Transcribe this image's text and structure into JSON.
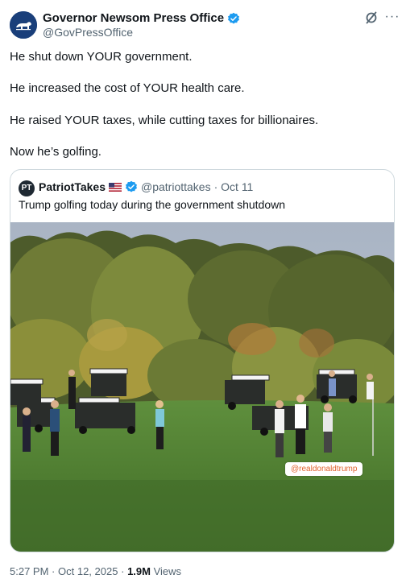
{
  "post": {
    "author_name": "Governor Newsom Press Office",
    "author_handle": "@GovPressOffice",
    "more_label": "···",
    "lines": [
      "He shut down YOUR government.",
      "He increased the cost of YOUR health care.",
      "He raised YOUR taxes, while cutting taxes for billionaires.",
      "Now he’s golfing."
    ],
    "time": "5:27 PM",
    "date": "Oct 12, 2025",
    "separator": "·",
    "views_count": "1.9M",
    "views_label": "Views"
  },
  "quote": {
    "avatar_text": "PT",
    "author_name": "PatriotTakes",
    "author_handle": "@patriottakes",
    "date": "· Oct 11",
    "text": "Trump golfing today during the government shutdown",
    "watermark": "@realdonaldtrump"
  },
  "colors": {
    "verified": "#1d9bf0",
    "text": "#0f1419",
    "muted": "#536471",
    "border": "#cfd9de",
    "avatar_bg": "#1a3f7a"
  },
  "icons": [
    "verified-badge-icon",
    "grok-icon",
    "more-icon",
    "us-flag-icon"
  ]
}
